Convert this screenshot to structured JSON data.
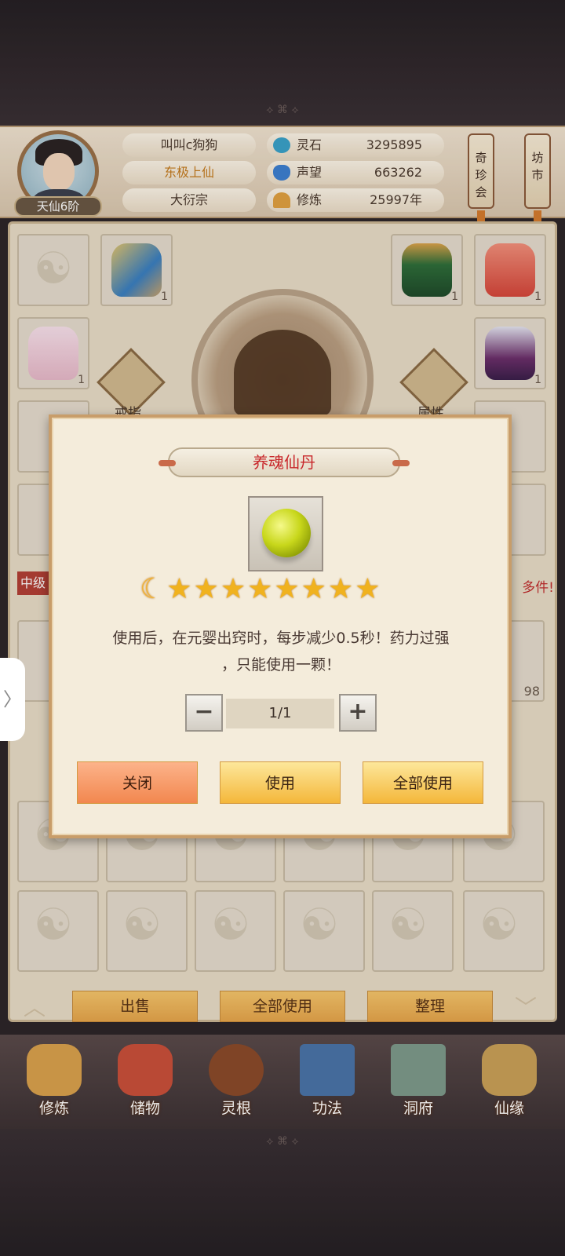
{
  "header": {
    "player_name": "叫叫c狗狗",
    "title": "东极上仙",
    "sect": "大衍宗",
    "rank": "天仙6阶",
    "resources": [
      {
        "label": "灵石",
        "value": "3295895",
        "icon": "spirit-stone-icon",
        "color": "#3aa1c8"
      },
      {
        "label": "声望",
        "value": "663262",
        "icon": "reputation-icon",
        "color": "#3d7fd0"
      },
      {
        "label": "修炼",
        "value": "25997年",
        "icon": "meditation-icon",
        "color": "#e0a040"
      }
    ],
    "side_buttons": [
      "奇珍会",
      "坊市"
    ]
  },
  "equipment": {
    "ring_label": "戒指",
    "attr_label": "属性",
    "slot_count": "1"
  },
  "storage": {
    "category_label": "中级",
    "notice": "多件!",
    "count_98": "98"
  },
  "bottom_actions": {
    "sell": "出售",
    "use_all": "全部使用",
    "sort": "整理"
  },
  "nav": [
    {
      "label": "修炼",
      "icon": "meditation-monk-icon",
      "color": "#d9a14c"
    },
    {
      "label": "储物",
      "icon": "storage-bag-icon",
      "color": "#c9503a"
    },
    {
      "label": "灵根",
      "icon": "spirit-root-icon",
      "color": "#8a4a2a"
    },
    {
      "label": "功法",
      "icon": "scripture-book-icon",
      "color": "#4a73a8"
    },
    {
      "label": "洞府",
      "icon": "cave-palace-icon",
      "color": "#7d9a8a"
    },
    {
      "label": "仙缘",
      "icon": "immortal-fate-icon",
      "color": "#c9a057"
    }
  ],
  "modal": {
    "title": "养魂仙丹",
    "item_icon": "golden-pill-icon",
    "moon": "☾",
    "stars": "★★★★★★★★",
    "description_line1": "使用后，在元婴出窍时，每步减少0.5秒！药力过强",
    "description_line2": "，只能使用一颗！",
    "quantity": "1/1",
    "minus": "−",
    "plus": "+",
    "close": "关闭",
    "use": "使用",
    "use_all": "全部使用"
  }
}
